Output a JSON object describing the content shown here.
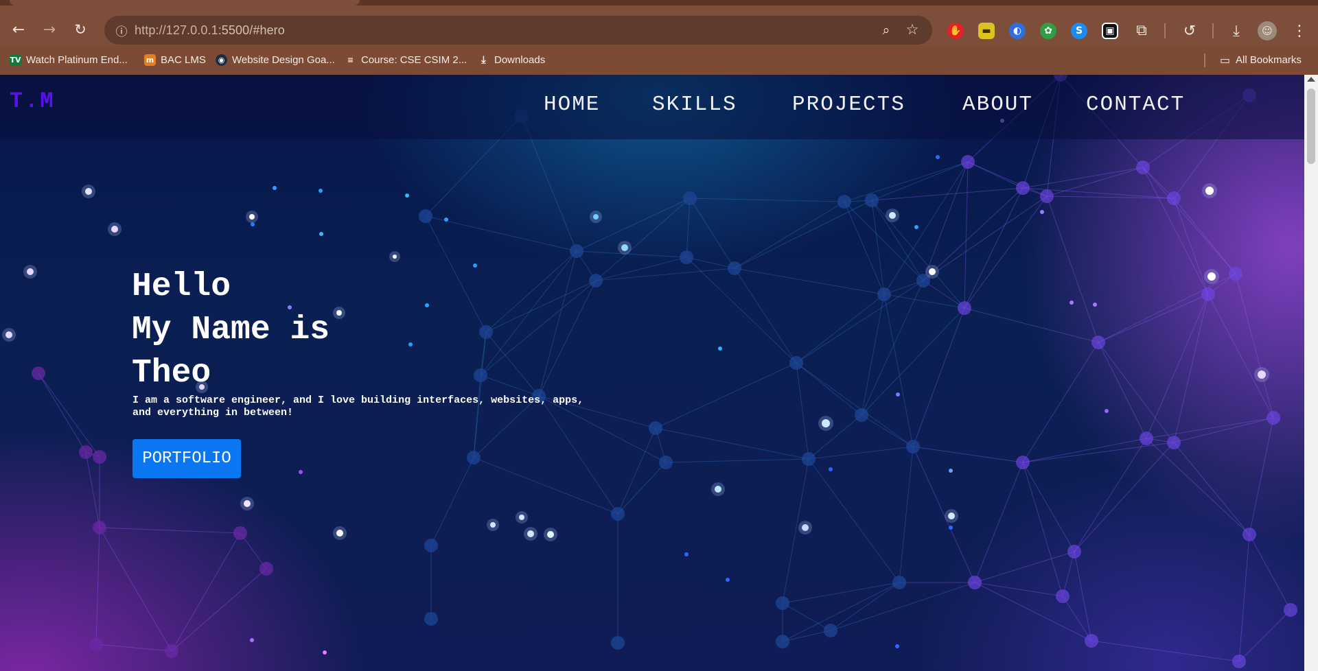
{
  "browser": {
    "url_host": "http://127.0.0.1",
    "url_rest": ":5500/#hero",
    "nav": {
      "back": "←",
      "forward": "→",
      "reload": "↻"
    },
    "bookmarks": [
      {
        "label": "Watch Platinum End...",
        "icon": "TV"
      },
      {
        "label": "BAC LMS",
        "icon": "m"
      },
      {
        "label": "Website Design Goa...",
        "icon": "◉"
      },
      {
        "label": "Course: CSE CSIM 2...",
        "icon": "≡"
      },
      {
        "label": "Downloads",
        "icon": "⤓"
      }
    ],
    "all_bookmarks": "All Bookmarks"
  },
  "site": {
    "logo": "T.M",
    "nav": [
      "HOME",
      "SKILLS",
      "PROJECTS",
      "ABOUT",
      "CONTACT"
    ],
    "hero": {
      "line1": "Hello",
      "line2": "My Name is",
      "line3": "Theo",
      "subtitle": "I am a software engineer, and I love building interfaces, websites, apps, and everything in between!",
      "button": "PORTFOLIO"
    }
  },
  "colors": {
    "logo": "#5b10f0",
    "button": "#0a76f2",
    "chrome": "#7b4b36"
  }
}
